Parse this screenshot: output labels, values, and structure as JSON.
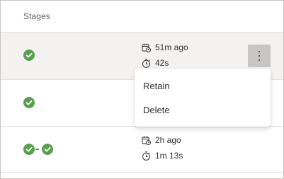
{
  "header": {
    "stages_label": "Stages"
  },
  "rows": [
    {
      "stages": [
        "succeeded"
      ],
      "time_ago": "51m ago",
      "duration": "42s",
      "selected": true
    },
    {
      "stages": [
        "succeeded"
      ],
      "selected": false
    },
    {
      "stages": [
        "succeeded",
        "succeeded"
      ],
      "time_ago": "2h ago",
      "duration": "1m 13s",
      "selected": false
    }
  ],
  "context_menu": {
    "items": [
      "Retain",
      "Delete"
    ]
  },
  "icons": {
    "stage_status": "check-circle-icon",
    "time_ago": "calendar-clock-icon",
    "duration": "stopwatch-icon",
    "more": "more-vertical-icon"
  },
  "colors": {
    "success": "#5a9e50",
    "selected_row": "#f3f2f1",
    "more_button_active": "#c8c6c4"
  }
}
